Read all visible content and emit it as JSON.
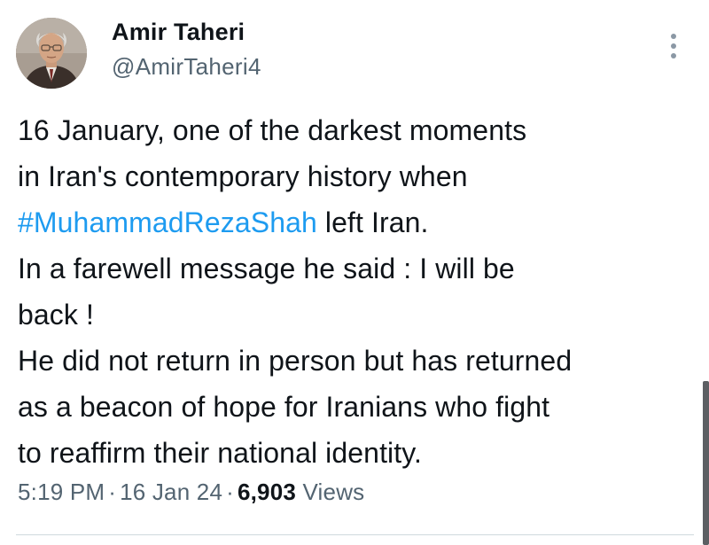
{
  "author": {
    "name": "Amir Taheri",
    "handle": "@AmirTaheri4",
    "avatar_icon": "profile-photo"
  },
  "tweet": {
    "line1": "16 January, one of the darkest moments",
    "line2": "in Iran's contemporary history when",
    "hashtag": "#MuhammadRezaShah",
    "line3_after": " left Iran.",
    "line4": "In a farewell message he said : I will be",
    "line5": "back !",
    "line6": "He did not return in person but has returned",
    "line7": "as a beacon of hope for Iranians who fight",
    "line8": "to reaffirm their national identity."
  },
  "meta": {
    "time": "5:19 PM",
    "separator": "·",
    "date": "16 Jan 24",
    "views_count": "6,903",
    "views_label": "Views"
  },
  "icons": {
    "more": "more-vertical-icon"
  },
  "colors": {
    "hashtag": "#1d9bf0",
    "secondary_text": "#536471",
    "primary_text": "#0f1419"
  }
}
